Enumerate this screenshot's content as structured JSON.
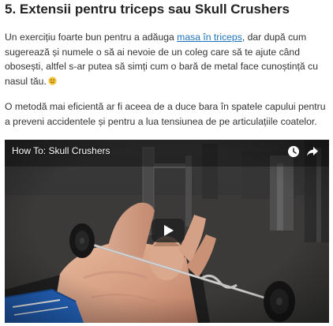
{
  "article": {
    "heading": "5. Extensii pentru triceps sau Skull Crushers",
    "paragraph1": {
      "before_link": "Un exercițiu foarte bun pentru a adăuga ",
      "link_text": "masa în triceps",
      "after_link": ", dar după cum sugerează și numele o să ai nevoie de un coleg care să te ajute când obosești, altfel s-ar putea să simți cum o bară de metal face cunoștință cu nasul tău."
    },
    "paragraph2": "O metodă mai eficientă ar fi aceea de a duce bara în spatele capului pentru a preveni accidentele și pentru a lua tensiunea de pe articulațiile coatelor."
  },
  "video": {
    "title": "How To: Skull Crushers",
    "icons": [
      "clock-icon",
      "share-icon",
      "play-icon"
    ]
  },
  "colors": {
    "link": "#1e73be",
    "text": "#333333",
    "heading": "#222222",
    "smiley": "#f5c33b"
  }
}
